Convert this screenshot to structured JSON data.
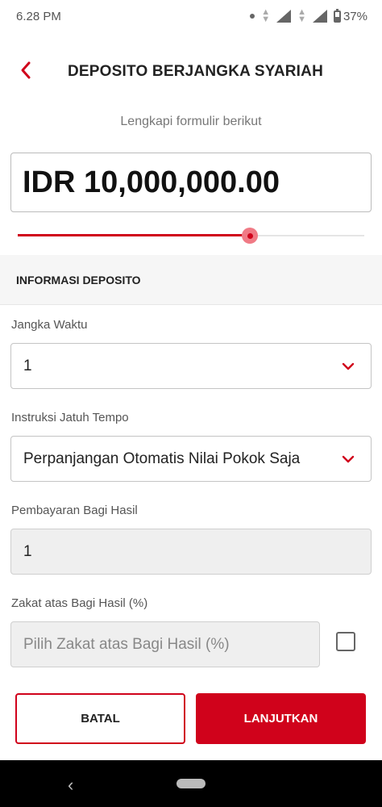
{
  "status": {
    "time": "6.28 PM",
    "battery": "37%"
  },
  "header": {
    "title": "DEPOSITO BERJANGKA SYARIAH"
  },
  "subtitle": "Lengkapi formulir berikut",
  "amount": "IDR 10,000,000.00",
  "slider": {
    "fraction": 0.67
  },
  "section_title": "INFORMASI DEPOSITO",
  "fields": {
    "jangka_waktu": {
      "label": "Jangka Waktu",
      "value": "1"
    },
    "instruksi": {
      "label": "Instruksi Jatuh Tempo",
      "value": "Perpanjangan Otomatis Nilai Pokok Saja"
    },
    "pembayaran": {
      "label": "Pembayaran Bagi Hasil",
      "value": "1"
    },
    "zakat": {
      "label": "Zakat atas Bagi Hasil (%)",
      "placeholder": "Pilih Zakat atas Bagi Hasil (%)"
    }
  },
  "buttons": {
    "cancel": "BATAL",
    "next": "LANJUTKAN"
  },
  "colors": {
    "accent": "#d0021b"
  },
  "icons": {
    "back": "chevron-left-icon",
    "dropdown": "chevron-down-icon"
  }
}
